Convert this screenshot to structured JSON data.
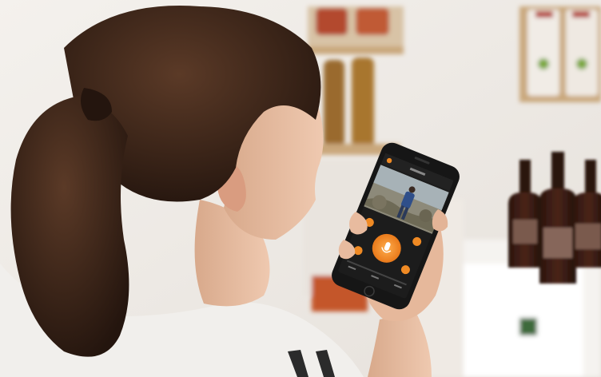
{
  "scene": {
    "description_tags": [
      "woman-holding-smartphone",
      "video-doorbell-app",
      "shop-background"
    ],
    "colors": {
      "wall": "#ece8e3",
      "hair": "#3a2418",
      "skin": "#e9bfa3",
      "sweater": "#f1efec",
      "phone_body": "#161616",
      "app_background": "#1c1c1c",
      "accent_orange": "#f08a24",
      "wine_bottle": "#3b1d15",
      "shelf_wood": "#c9a77c"
    }
  },
  "phone_app": {
    "main_button_icon": "microphone-icon",
    "side_button_icons": [
      "speaker-icon",
      "camera-icon",
      "video-icon",
      "end-call-icon"
    ],
    "feed_subject": "person-at-front-door"
  }
}
